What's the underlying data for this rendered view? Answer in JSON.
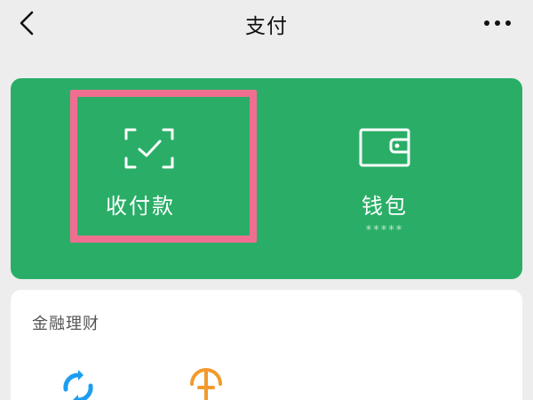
{
  "header": {
    "title": "支付"
  },
  "pay_card": {
    "collect_label": "收付款",
    "wallet_label": "钱包",
    "wallet_balance_masked": "*****",
    "highlight_color": "#f06f91",
    "background_color": "#2aae67"
  },
  "finance": {
    "section_title": "金融理财",
    "items": [
      {
        "icon": "blue-finance-icon"
      },
      {
        "icon": "orange-finance-icon"
      }
    ]
  },
  "icons": {
    "back": "chevron-left-icon",
    "more": "more-dots-icon",
    "collect": "scan-check-icon",
    "wallet": "wallet-icon"
  }
}
